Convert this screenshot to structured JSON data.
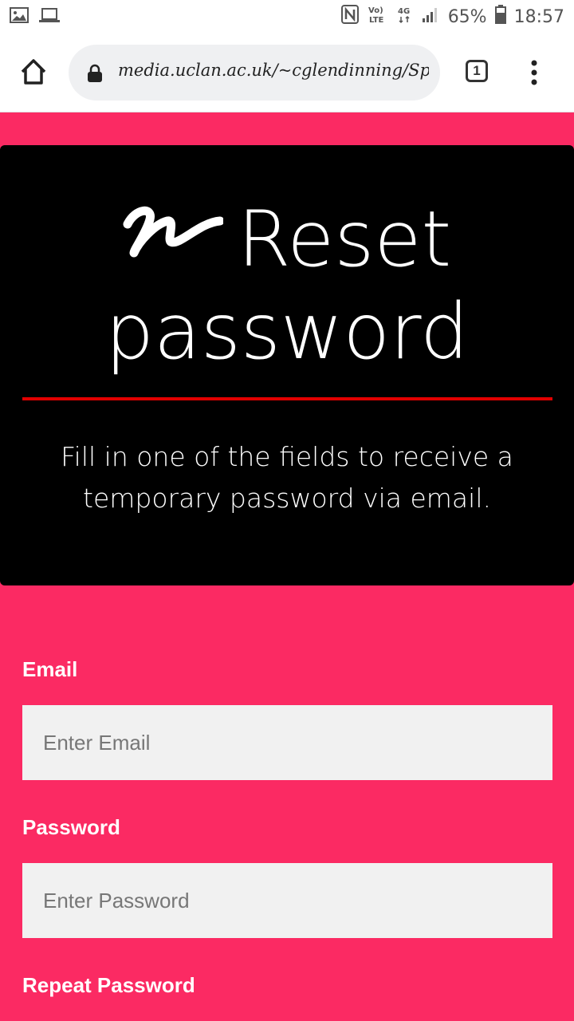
{
  "status_bar": {
    "left_icons": [
      "image-icon",
      "laptop-icon"
    ],
    "right_icons": [
      "nfc-icon",
      "volte-icon",
      "4g-icon",
      "signal-icon"
    ],
    "battery": "65%",
    "time": "18:57"
  },
  "browser": {
    "url": "media.uclan.ac.uk/~cglendinning/Spa",
    "tab_count": "1"
  },
  "hero": {
    "title_line1": "Reset",
    "title_line2": "password",
    "subtitle": "Fill in one of the fields to receive a temporary password via email."
  },
  "form": {
    "email_label": "Email",
    "email_placeholder": "Enter Email",
    "password_label": "Password",
    "password_placeholder": "Enter Password",
    "repeat_label": "Repeat Password"
  },
  "colors": {
    "page_bg": "#fb2a63",
    "hero_bg": "#000000",
    "accent_rule": "#e10000",
    "input_bg": "#f1f1f1"
  }
}
